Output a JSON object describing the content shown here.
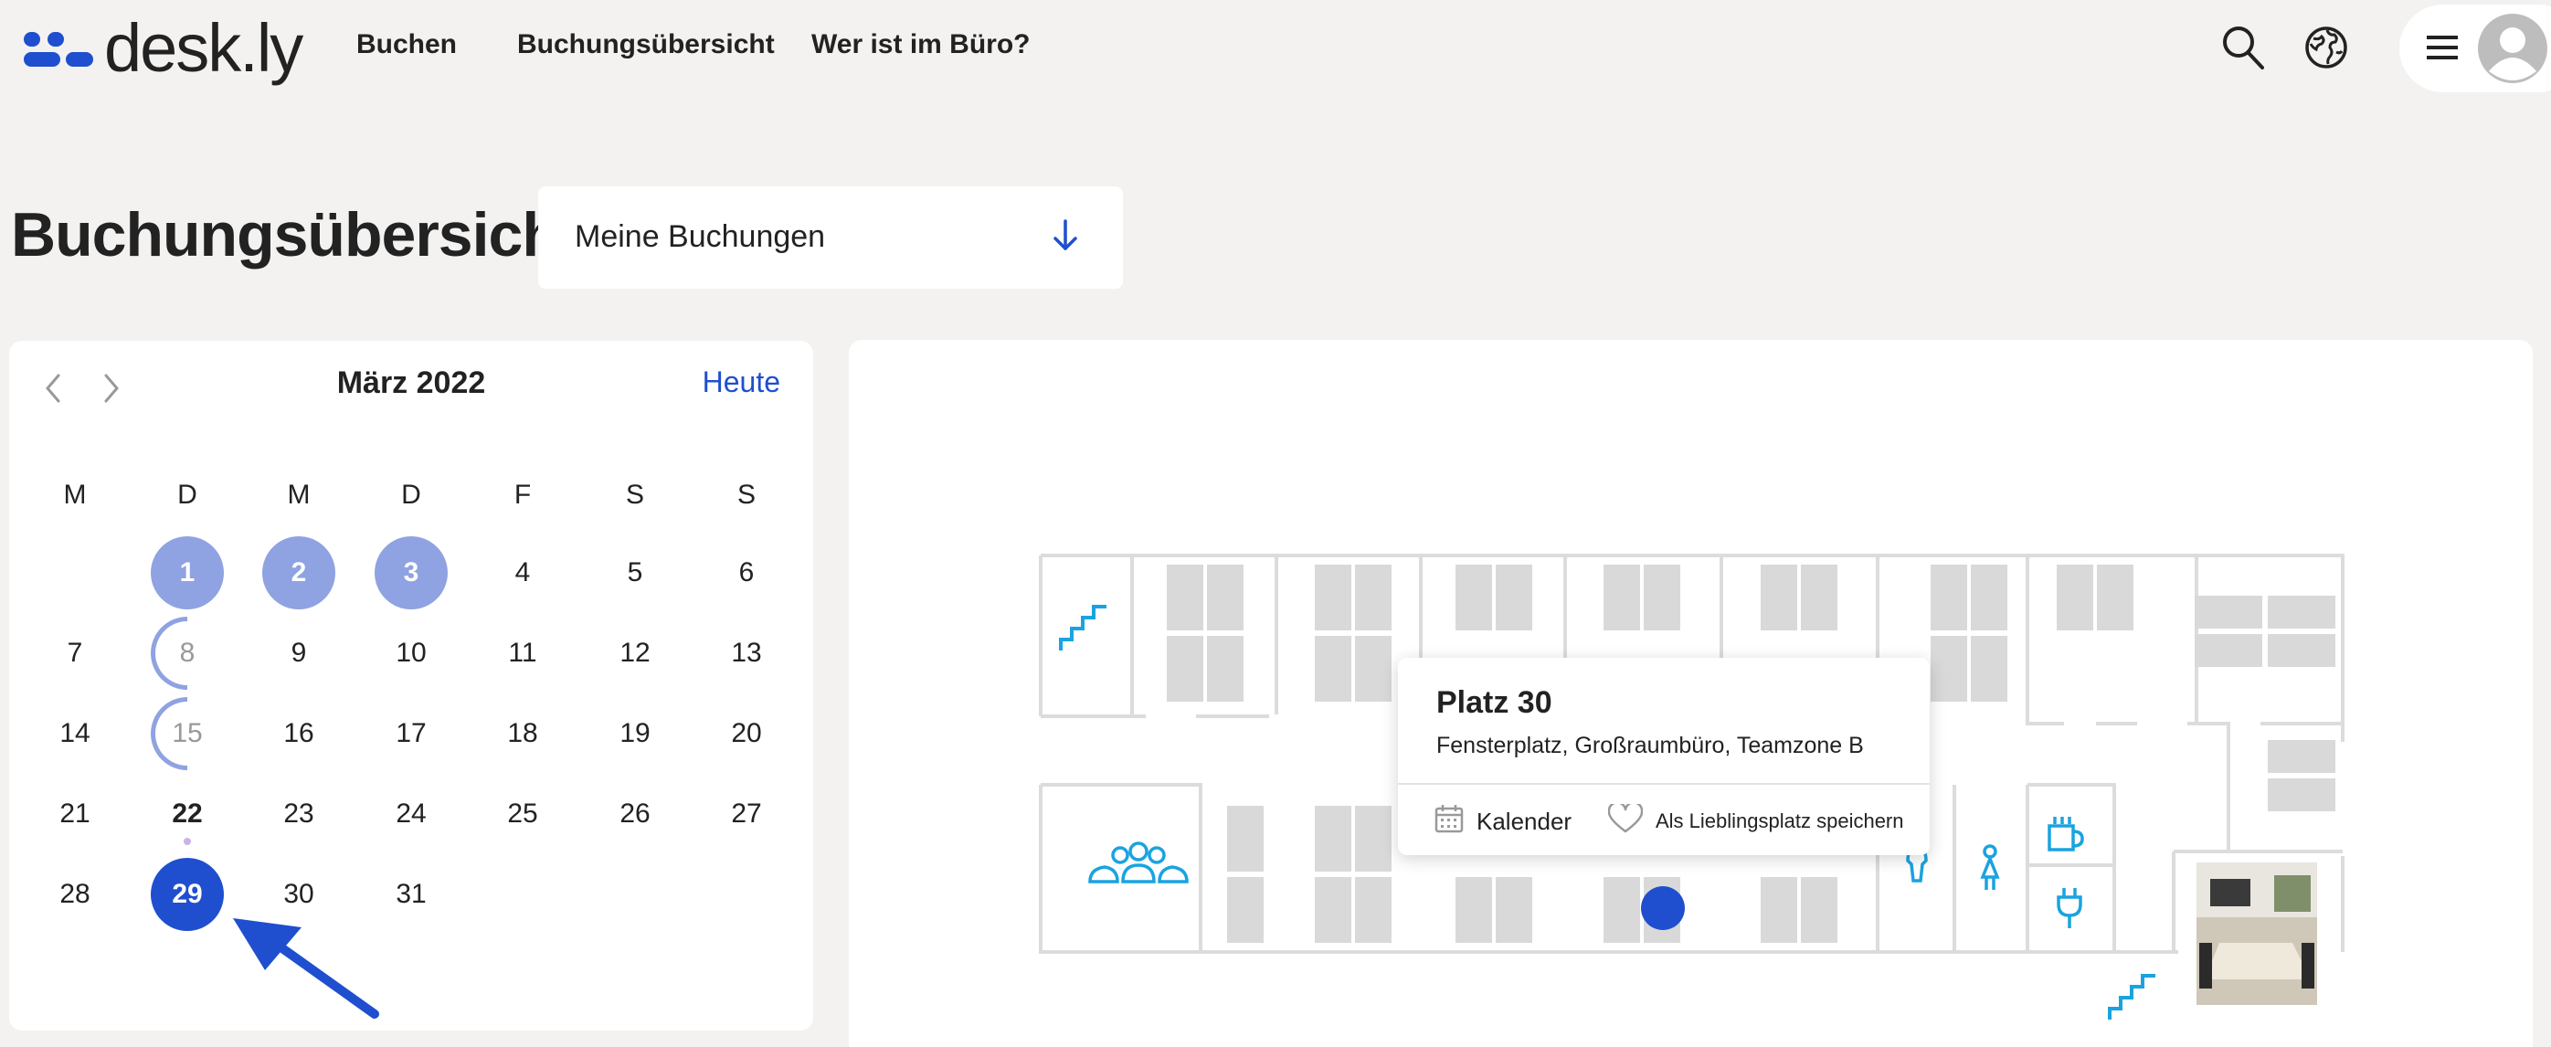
{
  "brand": {
    "name": "desk.ly",
    "color": "#1f4fcf"
  },
  "nav": {
    "items": [
      "Buchen",
      "Buchungsübersicht",
      "Wer ist im Büro?"
    ]
  },
  "header_icons": [
    "search-icon",
    "globe-icon",
    "menu-icon",
    "avatar-icon"
  ],
  "page": {
    "title": "Buchungsübersicht"
  },
  "filter": {
    "selected": "Meine Buchungen",
    "icon": "arrow-down-icon"
  },
  "calendar": {
    "month_label": "März 2022",
    "today_label": "Heute",
    "weekdays": [
      "M",
      "D",
      "M",
      "D",
      "F",
      "S",
      "S"
    ],
    "weeks": [
      [
        "",
        "1",
        "2",
        "3",
        "4",
        "5",
        "6"
      ],
      [
        "7",
        "8",
        "9",
        "10",
        "11",
        "12",
        "13"
      ],
      [
        "14",
        "15",
        "16",
        "17",
        "18",
        "19",
        "20"
      ],
      [
        "21",
        "22",
        "23",
        "24",
        "25",
        "26",
        "27"
      ],
      [
        "28",
        "29",
        "30",
        "31",
        "",
        "",
        ""
      ]
    ],
    "booked_days": [
      "1",
      "2",
      "3"
    ],
    "half_booked_days": [
      "8",
      "15"
    ],
    "today": "22",
    "selected_day": "29"
  },
  "popup": {
    "title": "Platz 30",
    "subtitle": "Fensterplatz, Großraumbüro, Teamzone B",
    "calendar_label": "Kalender",
    "favorite_label": "Als Lieblingsplatz speichern"
  },
  "map_icons": [
    "stairs-icon",
    "group-icon",
    "male-restroom-icon",
    "female-restroom-icon",
    "coffee-icon",
    "power-plug-icon",
    "stairs-icon",
    "meeting-room-photo"
  ]
}
